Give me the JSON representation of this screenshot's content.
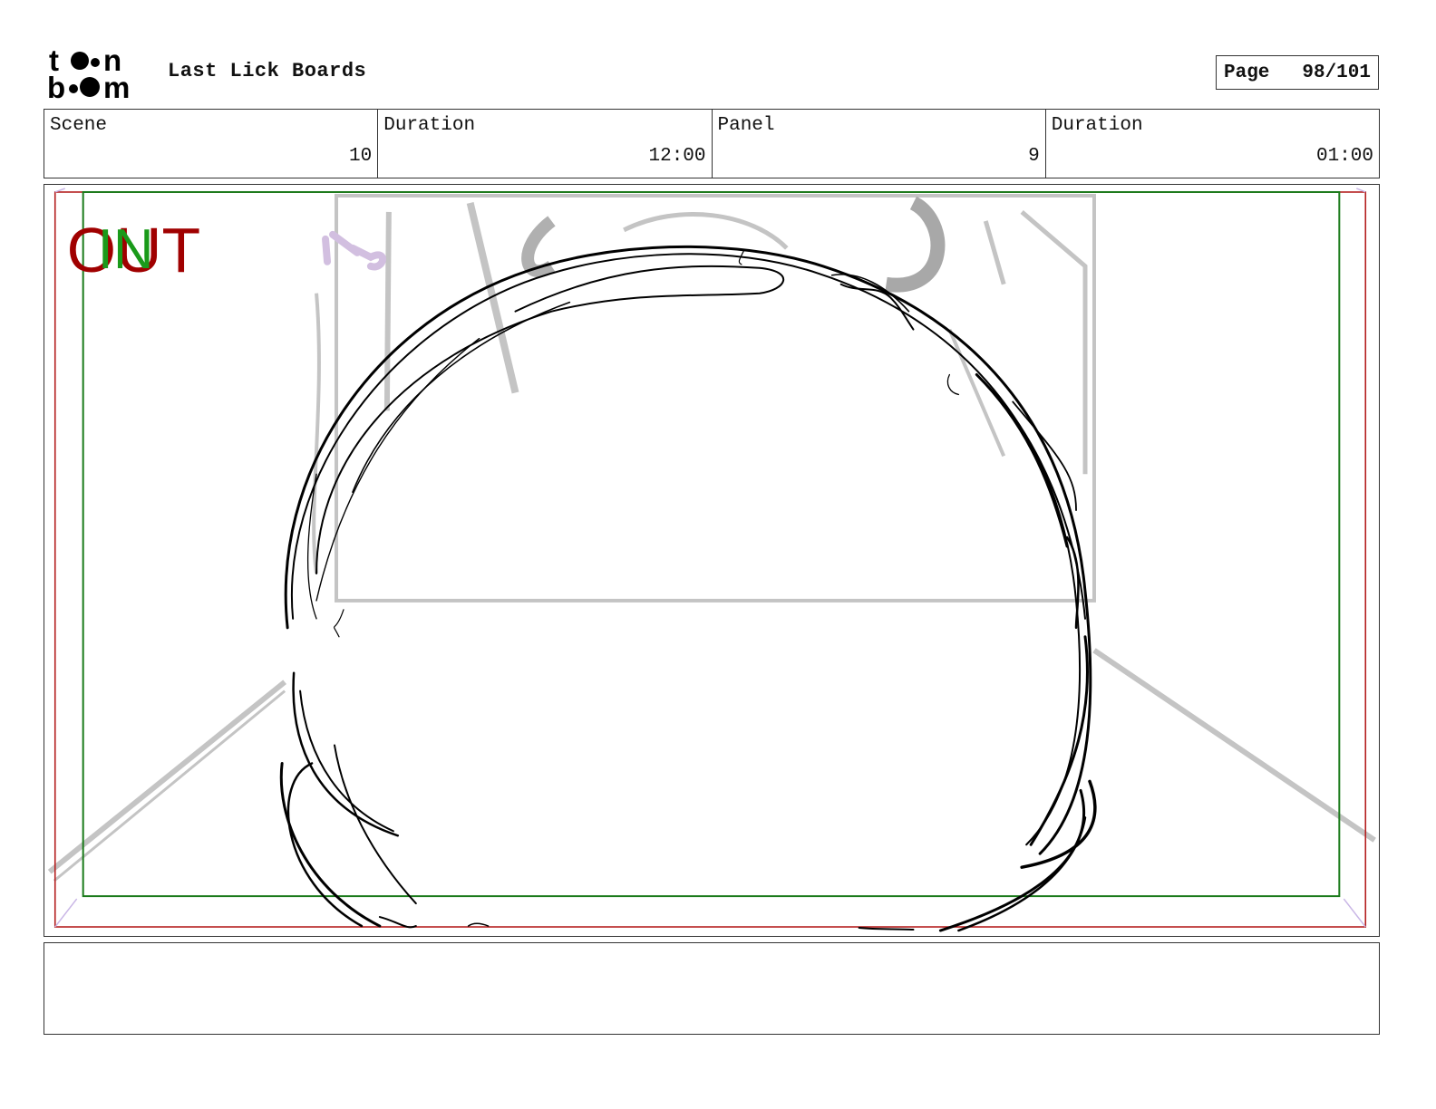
{
  "header": {
    "logo_text_top": "toon",
    "logo_text_bottom": "boom",
    "title": "Last Lick Boards",
    "page_label": "Page",
    "page_value": "98/101"
  },
  "info": {
    "scene_label": "Scene",
    "scene_value": "10",
    "scene_duration_label": "Duration",
    "scene_duration_value": "12:00",
    "panel_label": "Panel",
    "panel_value": "9",
    "panel_duration_label": "Duration",
    "panel_duration_value": "01:00"
  },
  "panel": {
    "out_marker": "OUT",
    "in_marker": "IN",
    "out_color": "#a00000",
    "in_color": "#1a9a1a"
  },
  "notes": {
    "text": ""
  }
}
